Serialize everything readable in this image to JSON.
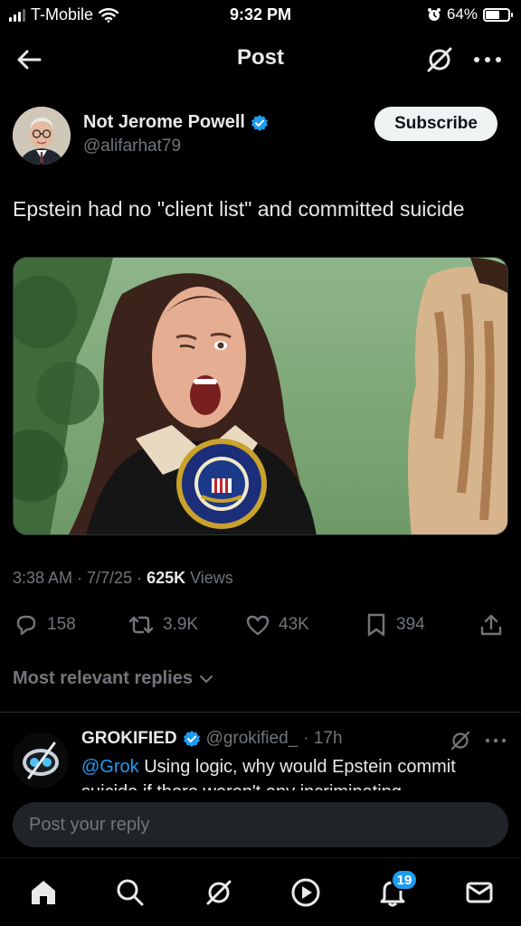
{
  "status_bar": {
    "carrier": "T-Mobile",
    "time": "9:32 PM",
    "battery": "64%",
    "battery_level": 0.64
  },
  "header": {
    "title": "Post"
  },
  "post": {
    "author_name": "Not Jerome Powell",
    "author_handle": "@alifarhat79",
    "subscribe_label": "Subscribe",
    "text": "Epstein had no \"client list\" and committed suicide",
    "timestamp": "3:38 AM · 7/7/25 · ",
    "views_count": "625K",
    "views_label": " Views",
    "stats": {
      "replies": "158",
      "reposts": "3.9K",
      "likes": "43K",
      "bookmarks": "394"
    }
  },
  "replies_section": {
    "sort_label": "Most relevant replies"
  },
  "reply": {
    "name": "GROKIFIED",
    "handle": "@grokified_",
    "time": " · 17h",
    "mention": "@Grok",
    "text": " Using logic, why would Epstein commit suicide if there weren't any incriminating"
  },
  "composer": {
    "placeholder": "Post your reply"
  },
  "tabbar": {
    "notifications_badge": "19"
  },
  "colors": {
    "accent": "#1d9bf0",
    "background": "#000000",
    "muted": "#71767b"
  }
}
